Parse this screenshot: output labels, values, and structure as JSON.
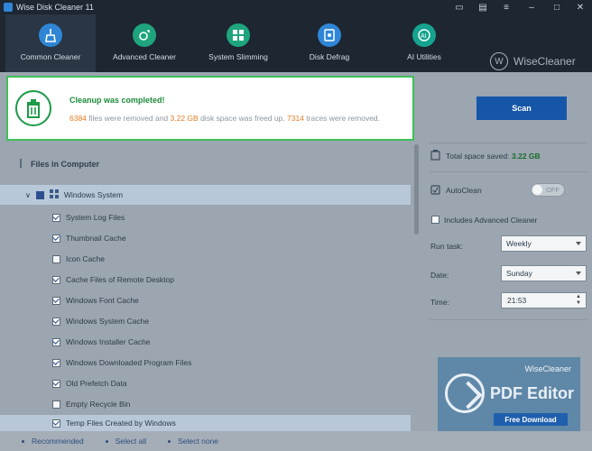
{
  "window": {
    "title": "Wise Disk Cleaner 11",
    "controls": [
      "chat-icon",
      "notes-icon",
      "menu-icon",
      "minimize-icon",
      "maximize-icon",
      "close-icon"
    ]
  },
  "nav": {
    "items": [
      {
        "label": "Common Cleaner",
        "icon": "broom-icon",
        "active": true
      },
      {
        "label": "Advanced Cleaner",
        "icon": "advanced-icon",
        "active": false
      },
      {
        "label": "System Slimming",
        "icon": "windows-icon",
        "active": false
      },
      {
        "label": "Disk Defrag",
        "icon": "defrag-icon",
        "active": false
      },
      {
        "label": "AI Utilities",
        "icon": "ai-icon",
        "active": false
      }
    ],
    "brand": "WiseCleaner"
  },
  "notice": {
    "title": "Cleanup was completed!",
    "files_removed": "6384",
    "text1": " files were removed and ",
    "space_freed": "3.22 GB",
    "text2": " disk space was freed up. ",
    "traces_removed": "7314",
    "text3": " traces were removed."
  },
  "files": {
    "section_title": "Files in Computer",
    "group": "Windows System",
    "items": [
      {
        "label": "System Log Files",
        "checked": true
      },
      {
        "label": "Thumbnail Cache",
        "checked": true
      },
      {
        "label": "Icon Cache",
        "checked": false
      },
      {
        "label": "Cache Files of Remote Desktop",
        "checked": true
      },
      {
        "label": "Windows Font Cache",
        "checked": true
      },
      {
        "label": "Windows System Cache",
        "checked": true
      },
      {
        "label": "Windows Installer Cache",
        "checked": true
      },
      {
        "label": "Windows Downloaded Program Files",
        "checked": true
      },
      {
        "label": "Old Prefetch Data",
        "checked": true
      },
      {
        "label": "Empty Recycle Bin",
        "checked": false
      },
      {
        "label": "Temp Files Created by Windows",
        "checked": true
      }
    ]
  },
  "bottom": {
    "links": [
      "Recommended",
      "Select all",
      "Select none"
    ]
  },
  "right": {
    "scan_label": "Scan",
    "total_label": "Total space saved:",
    "total_value": "3.22 GB",
    "autoclean_label": "AutoClean",
    "toggle_state": "OFF",
    "advanced_label": "Includes Advanced Cleaner",
    "run_task_label": "Run task:",
    "run_task_value": "Weekly",
    "date_label": "Date:",
    "date_value": "Sunday",
    "time_label": "Time:",
    "time_value": "21:53",
    "ad_brand": "WiseCleaner",
    "ad_title": "PDF Editor",
    "ad_button": "Free Download"
  },
  "colors": {
    "accent": "#1556a8",
    "success": "#1b8b3a",
    "highlight_number": "#e67b26"
  }
}
